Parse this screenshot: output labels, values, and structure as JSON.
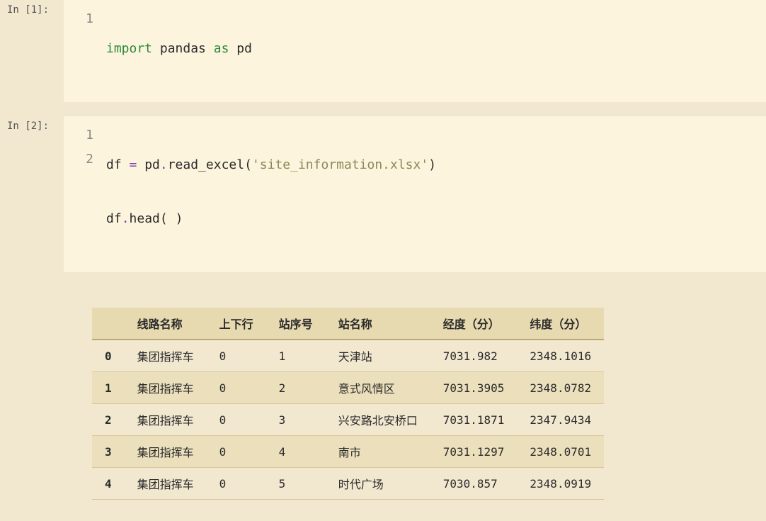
{
  "cells": {
    "cell1": {
      "prompt": "In [1]:",
      "lines": [
        {
          "gutter": "1",
          "type": "import"
        }
      ],
      "tokens": {
        "import": "import",
        "pandas": "pandas",
        "as": "as",
        "pd": "pd"
      }
    },
    "cell2": {
      "prompt": "In [2]:",
      "lines": [
        {
          "gutter": "1"
        },
        {
          "gutter": "2"
        }
      ],
      "tokens": {
        "df": "df ",
        "eq": "=",
        "pd": " pd",
        "dot1": ".",
        "read_excel": "read_excel",
        "lparen": "(",
        "str": "'site_information.xlsx'",
        "rparen": ")",
        "df2": "df",
        "dot2": ".",
        "head": "head",
        "call": "( )"
      }
    }
  },
  "table": {
    "columns": [
      "线路名称",
      "上下行",
      "站序号",
      "站名称",
      "经度（分）",
      "纬度（分）"
    ],
    "index": [
      "0",
      "1",
      "2",
      "3",
      "4"
    ],
    "rows": [
      [
        "集团指挥车",
        "0",
        "1",
        "天津站",
        "7031.982",
        "2348.1016"
      ],
      [
        "集团指挥车",
        "0",
        "2",
        "意式风情区",
        "7031.3905",
        "2348.0782"
      ],
      [
        "集团指挥车",
        "0",
        "3",
        "兴安路北安桥口",
        "7031.1871",
        "2347.9434"
      ],
      [
        "集团指挥车",
        "0",
        "4",
        "南市",
        "7031.1297",
        "2348.0701"
      ],
      [
        "集团指挥车",
        "0",
        "5",
        "时代广场",
        "7030.857",
        "2348.0919"
      ]
    ]
  }
}
